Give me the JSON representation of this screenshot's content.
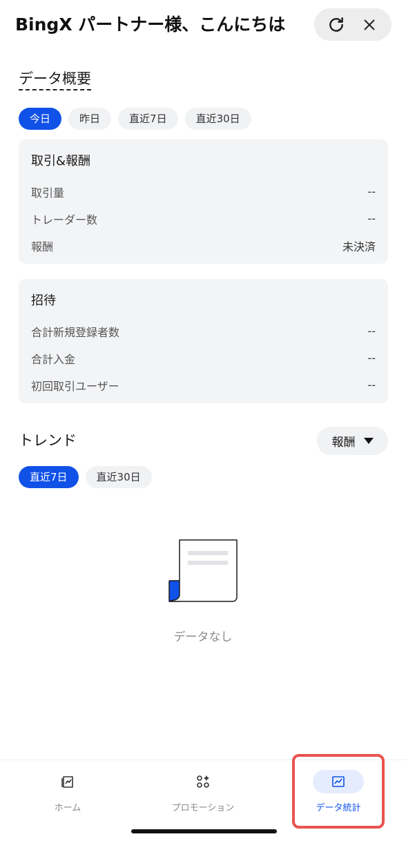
{
  "header": {
    "title": "BingX パートナー様、こんにちは",
    "refresh_icon": "refresh-icon",
    "close_icon": "close-icon"
  },
  "overview": {
    "title": "データ概要",
    "tabs": [
      "今日",
      "昨日",
      "直近7日",
      "直近30日"
    ],
    "active_tab": 0
  },
  "trade_card": {
    "title": "取引&報酬",
    "rows": [
      {
        "label": "取引量",
        "value": "--"
      },
      {
        "label": "トレーダー数",
        "value": "--"
      },
      {
        "label": "報酬",
        "value": "未決済"
      }
    ]
  },
  "invite_card": {
    "title": "招待",
    "rows": [
      {
        "label": "合計新規登録者数",
        "value": "--"
      },
      {
        "label": "合計入金",
        "value": "--"
      },
      {
        "label": "初回取引ユーザー",
        "value": "--"
      }
    ]
  },
  "trend": {
    "title": "トレンド",
    "dropdown_value": "報酬",
    "tabs": [
      "直近7日",
      "直近30日"
    ],
    "active_tab": 0,
    "empty_text": "データなし"
  },
  "bottom_nav": {
    "items": [
      {
        "label": "ホーム",
        "icon": "home-icon"
      },
      {
        "label": "プロモーション",
        "icon": "promotion-icon"
      },
      {
        "label": "データ統計",
        "icon": "chart-icon"
      }
    ],
    "active_index": 2
  },
  "colors": {
    "accent": "#1051e8",
    "card_bg": "#f3f4f6",
    "highlight": "#e8534f"
  }
}
